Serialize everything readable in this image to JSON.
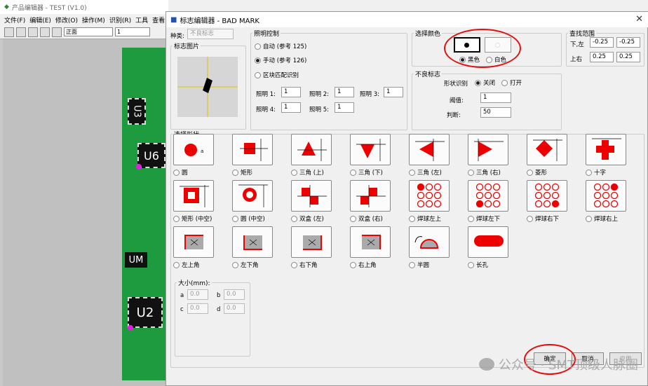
{
  "bg_app": {
    "title": "产品编辑器 - TEST (V1.0)",
    "menu": [
      "文件(F)",
      "编辑(E)",
      "修改(O)",
      "操作(M)",
      "识别(R)",
      "工具",
      "查看"
    ],
    "combo1": "正面",
    "combo2": "1",
    "chips": {
      "u3": "U3",
      "u6": "U6",
      "um": "UM",
      "u2": "U2"
    }
  },
  "dialog": {
    "title": "标志编辑器 - BAD MARK",
    "type_label": "种类:",
    "type_value": "不良标志",
    "mark_image_label": "标志图片",
    "lighting": {
      "legend": "照明控制",
      "auto": "自动 (参考 125)",
      "manual": "手动 (参考 126)",
      "block": "区块匹配识别",
      "l1": "照明 1:",
      "v1": "1",
      "l2": "照明 2:",
      "v2": "1",
      "l3": "照明 3:",
      "v3": "1",
      "l4": "照明 4:",
      "v4": "1",
      "l5": "照明 5:",
      "v5": "1"
    },
    "color": {
      "legend": "选择颜色",
      "black": "黑色",
      "white": "白色"
    },
    "search": {
      "legend": "查找范围",
      "lower_left": "下,左",
      "upper_right": "上右",
      "v1": "-0.25",
      "v2": "-0.25",
      "v3": "0.25",
      "v4": "0.25"
    },
    "bad": {
      "legend": "不良标志",
      "shape_recog": "形状识别",
      "off": "关闭",
      "on": "打开",
      "threshold_label": "阈值:",
      "threshold": "1",
      "judge_label": "判断:",
      "judge": "50"
    },
    "shapes_legend": "选择形状",
    "shapes": [
      "圆",
      "矩形",
      "三角 (上)",
      "三角 (下)",
      "三角 (左)",
      "三角 (右)",
      "菱形",
      "十字",
      "矩形 (中空)",
      "圆 (中空)",
      "双盒 (左)",
      "双盒 (右)",
      "焊球左上",
      "焊球左下",
      "焊球右下",
      "焊球右上",
      "左上角",
      "左下角",
      "右下角",
      "右上角",
      "半圆",
      "长孔"
    ],
    "size": {
      "legend": "大小(mm):",
      "a": "a",
      "b": "b",
      "c": "c",
      "d": "d",
      "va": "0.0",
      "vb": "0.0",
      "vc": "0.0",
      "vd": "0.0"
    },
    "ok": "确定",
    "cancel": "取消",
    "apply": "应用"
  },
  "watermark": "公众号 · SMT顶级人脉圈"
}
